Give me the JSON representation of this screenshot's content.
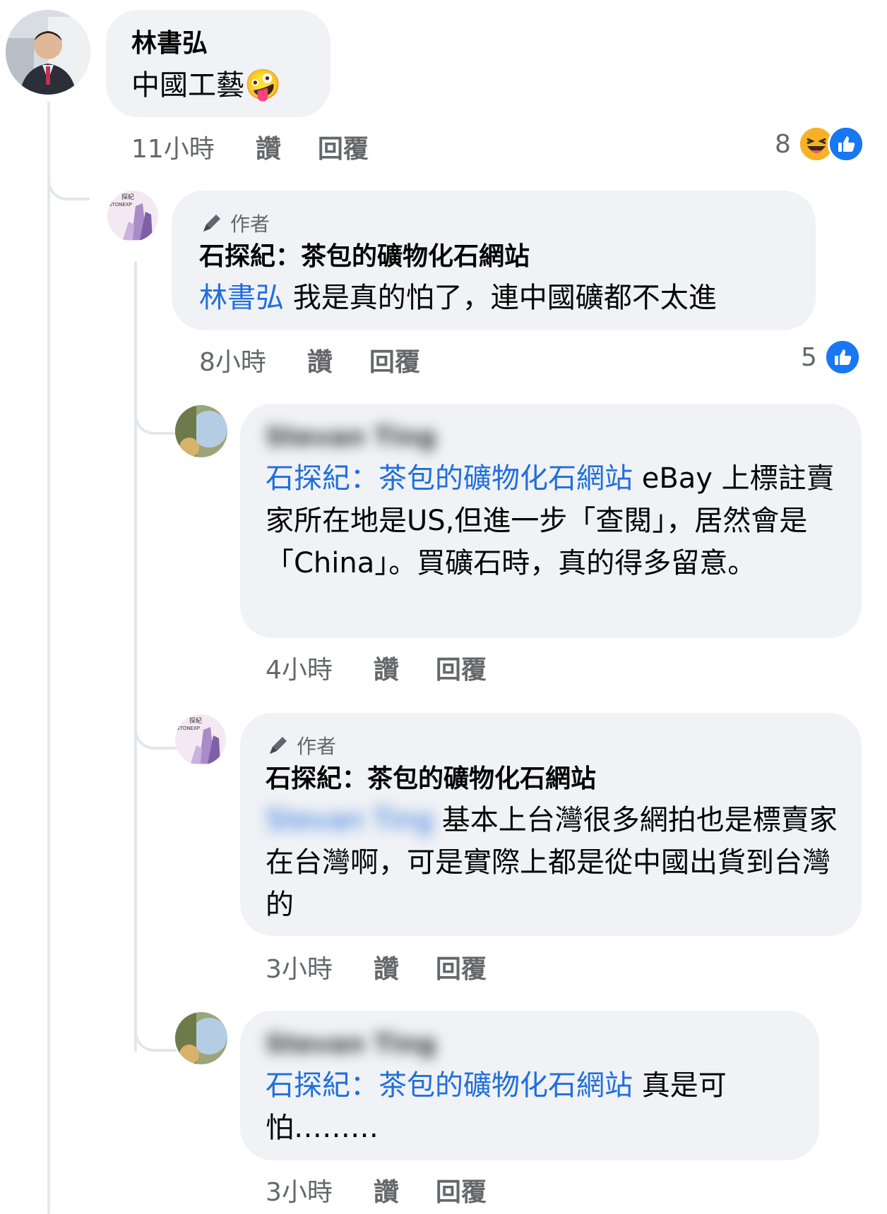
{
  "comments": [
    {
      "author": "林書弘",
      "text": "中國工藝",
      "emoji": "🤪",
      "time": "11小時",
      "like": "讚",
      "reply": "回覆",
      "reaction_count": "8",
      "reactions": [
        "laugh-react-icon",
        "like-react-icon"
      ]
    },
    {
      "badge": "作者",
      "author": "石探紀：茶包的礦物化石網站",
      "mention": "林書弘",
      "text": " 我是真的怕了，連中國礦都不太進",
      "time": "8小時",
      "like": "讚",
      "reply": "回覆",
      "reaction_count": "5",
      "reactions": [
        "like-react-icon"
      ]
    },
    {
      "author": "Stevan Ting",
      "mention": "石探紀：茶包的礦物化石網站",
      "text": " eBay 上標註賣家所在地是US,但進一步「查閱」，居然會是「China」。買礦石時，真的得多留意。",
      "time": "4小時",
      "like": "讚",
      "reply": "回覆"
    },
    {
      "badge": "作者",
      "author": "石探紀：茶包的礦物化石網站",
      "mention": "Stevan Ting",
      "text": " 基本上台灣很多網拍也是標賣家在台灣啊，可是實際上都是從中國出貨到台灣的",
      "time": "3小時",
      "like": "讚",
      "reply": "回覆"
    },
    {
      "author": "Stevan Ting",
      "mention": "石探紀：茶包的礦物化石網站",
      "text": " 真是可怕………",
      "time": "3小時",
      "like": "讚",
      "reply": "回覆"
    }
  ],
  "colors": {
    "bubble": "#f0f2f5",
    "mention": "#216fdb",
    "meta": "#65676b",
    "like_blue": "#1877f2",
    "laugh_yellow": "#f7b125"
  }
}
